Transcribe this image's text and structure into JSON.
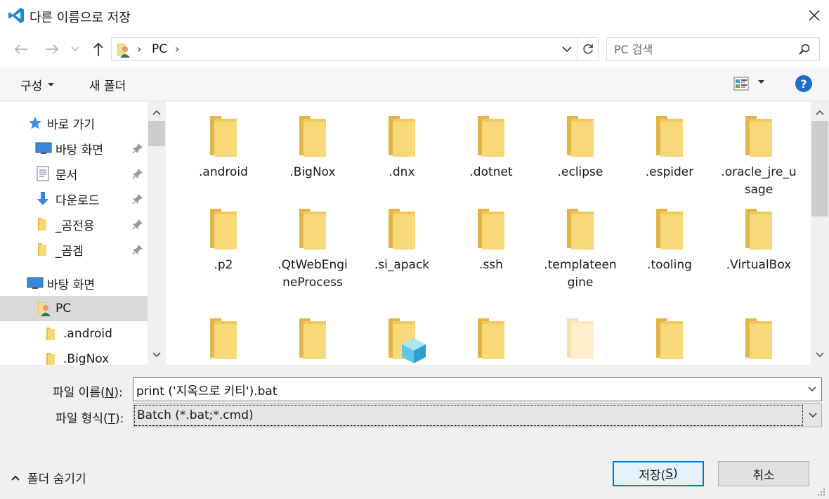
{
  "window": {
    "title": "다른 이름으로 저장",
    "accent_color": "#0078d7"
  },
  "nav": {
    "breadcrumb": [
      "PC"
    ],
    "search_placeholder": "PC 검색"
  },
  "toolbar": {
    "organize_label": "구성",
    "new_folder_label": "새 폴더",
    "help_label": "?"
  },
  "sidebar": {
    "items": [
      {
        "label": "바로 가기",
        "icon": "star-icon",
        "pinned": false
      },
      {
        "label": "바탕 화면",
        "icon": "desktop-icon",
        "pinned": true
      },
      {
        "label": "문서",
        "icon": "document-icon",
        "pinned": true
      },
      {
        "label": "다운로드",
        "icon": "download-icon",
        "pinned": true
      },
      {
        "label": "_곰전용",
        "icon": "folder-icon",
        "pinned": true
      },
      {
        "label": "_곰겜",
        "icon": "folder-icon",
        "pinned": true
      },
      {
        "label": "바탕 화면",
        "icon": "desktop-icon",
        "pinned": false
      },
      {
        "label": "PC",
        "icon": "pc-icon",
        "pinned": false,
        "selected": true
      },
      {
        "label": ".android",
        "icon": "folder-icon",
        "pinned": false
      },
      {
        "label": ".BigNox",
        "icon": "folder-icon",
        "pinned": false
      }
    ]
  },
  "files": [
    {
      "name": ".android"
    },
    {
      "name": ".BigNox"
    },
    {
      "name": ".dnx"
    },
    {
      "name": ".dotnet"
    },
    {
      "name": ".eclipse"
    },
    {
      "name": ".espider"
    },
    {
      "name": ".oracle_jre_usage"
    },
    {
      "name": ".p2"
    },
    {
      "name": ".QtWebEngineProcess"
    },
    {
      "name": ".si_apack"
    },
    {
      "name": ".ssh"
    },
    {
      "name": ".templateengine"
    },
    {
      "name": ".tooling"
    },
    {
      "name": ".VirtualBox"
    }
  ],
  "form": {
    "filename_label": "파일 이름(",
    "filename_key": "N",
    "filename_label_end": "):",
    "filename_value": "print ('지옥으로 키티').bat",
    "filetype_label": "파일 형식(",
    "filetype_key": "T",
    "filetype_label_end": "):",
    "filetype_value": "Batch (*.bat;*.cmd)"
  },
  "footer": {
    "hide_folders_label": "폴더 숨기기",
    "save_label": "저장(",
    "save_key": "S",
    "save_label_end": ")",
    "cancel_label": "취소"
  }
}
